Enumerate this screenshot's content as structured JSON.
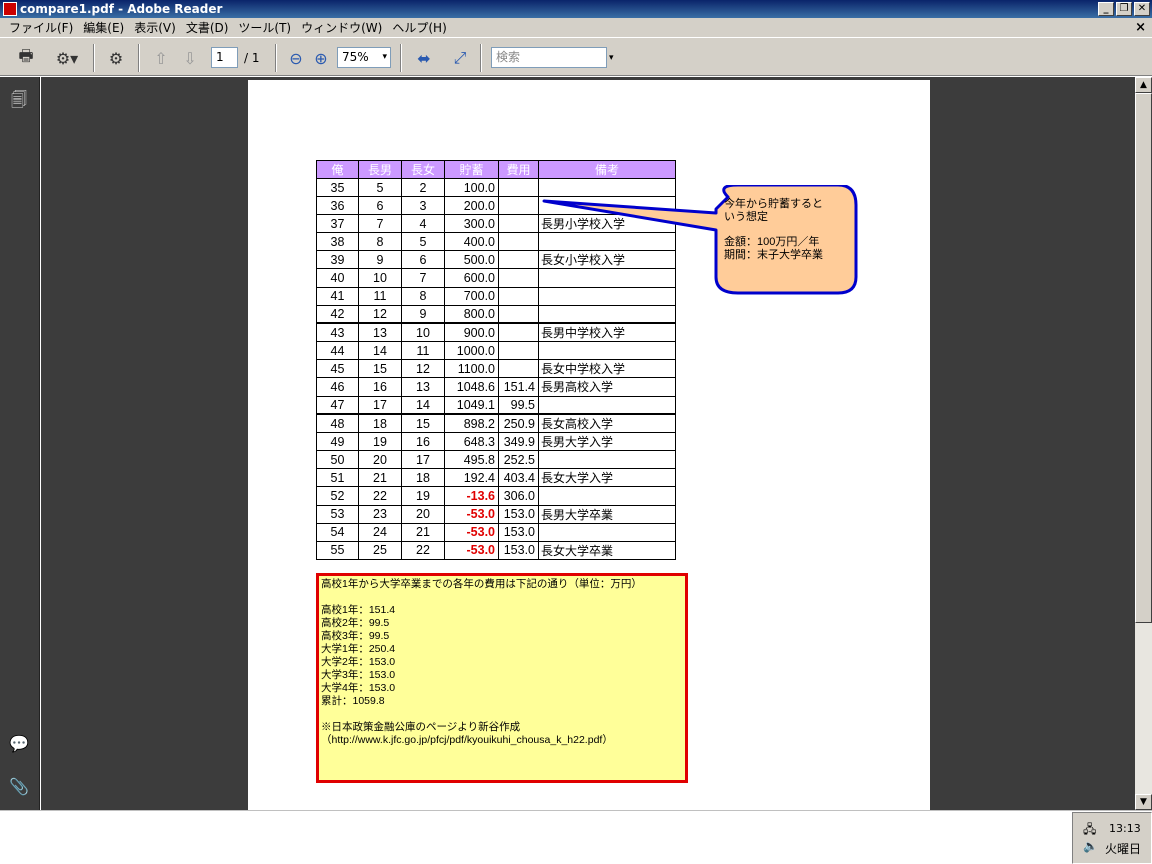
{
  "window": {
    "title": "compare1.pdf - Adobe Reader"
  },
  "menu": [
    "ファイル(F)",
    "編集(E)",
    "表示(V)",
    "文書(D)",
    "ツール(T)",
    "ウィンドウ(W)",
    "ヘルプ(H)"
  ],
  "toolbar": {
    "page_current": "1",
    "page_total": "/ 1",
    "zoom": "75%",
    "search_placeholder": "検索"
  },
  "table": {
    "headers": [
      "俺",
      "長男",
      "長女",
      "貯蓄",
      "費用",
      "備考"
    ],
    "rows": [
      [
        "35",
        "5",
        "2",
        "100.0",
        "",
        ""
      ],
      [
        "36",
        "6",
        "3",
        "200.0",
        "",
        ""
      ],
      [
        "37",
        "7",
        "4",
        "300.0",
        "",
        "長男小学校入学"
      ],
      [
        "38",
        "8",
        "5",
        "400.0",
        "",
        ""
      ],
      [
        "39",
        "9",
        "6",
        "500.0",
        "",
        "長女小学校入学"
      ],
      [
        "40",
        "10",
        "7",
        "600.0",
        "",
        ""
      ],
      [
        "41",
        "11",
        "8",
        "700.0",
        "",
        ""
      ],
      [
        "42",
        "12",
        "9",
        "800.0",
        "",
        ""
      ],
      [
        "43",
        "13",
        "10",
        "900.0",
        "",
        "長男中学校入学"
      ],
      [
        "44",
        "14",
        "11",
        "1000.0",
        "",
        ""
      ],
      [
        "45",
        "15",
        "12",
        "1100.0",
        "",
        "長女中学校入学"
      ],
      [
        "46",
        "16",
        "13",
        "1048.6",
        "151.4",
        "長男高校入学"
      ],
      [
        "47",
        "17",
        "14",
        "1049.1",
        "99.5",
        ""
      ],
      [
        "48",
        "18",
        "15",
        "898.2",
        "250.9",
        "長女高校入学"
      ],
      [
        "49",
        "19",
        "16",
        "648.3",
        "349.9",
        "長男大学入学"
      ],
      [
        "50",
        "20",
        "17",
        "495.8",
        "252.5",
        ""
      ],
      [
        "51",
        "21",
        "18",
        "192.4",
        "403.4",
        "長女大学入学"
      ],
      [
        "52",
        "22",
        "19",
        "-13.6",
        "306.0",
        ""
      ],
      [
        "53",
        "23",
        "20",
        "-53.0",
        "153.0",
        "長男大学卒業"
      ],
      [
        "54",
        "24",
        "21",
        "-53.0",
        "153.0",
        ""
      ],
      [
        "55",
        "25",
        "22",
        "-53.0",
        "153.0",
        "長女大学卒業"
      ]
    ]
  },
  "callout": {
    "line1": "今年から貯蓄すると",
    "line2": "いう想定",
    "line3": "金額：100万円／年",
    "line4": "期間：末子大学卒業"
  },
  "notebox": {
    "lines": [
      "高校1年から大学卒業までの各年の費用は下記の通り（単位：万円）",
      "",
      "高校1年：151.4",
      "高校2年：99.5",
      "高校3年：99.5",
      "大学1年：250.4",
      "大学2年：153.0",
      "大学3年：153.0",
      "大学4年：153.0",
      "累計：1059.8",
      "",
      "※日本政策金融公庫のページより新谷作成",
      "（http://www.k.jfc.go.jp/pfcj/pdf/kyouikuhi_chousa_k_h22.pdf）"
    ]
  },
  "tray": {
    "time": "13:13",
    "day": "火曜日"
  },
  "colors": {
    "header_bg": "#cc99ff",
    "negative": "#e00000",
    "note_bg": "#ffff99",
    "callout_bg": "#ffcc99",
    "callout_border": "#0000cc"
  }
}
